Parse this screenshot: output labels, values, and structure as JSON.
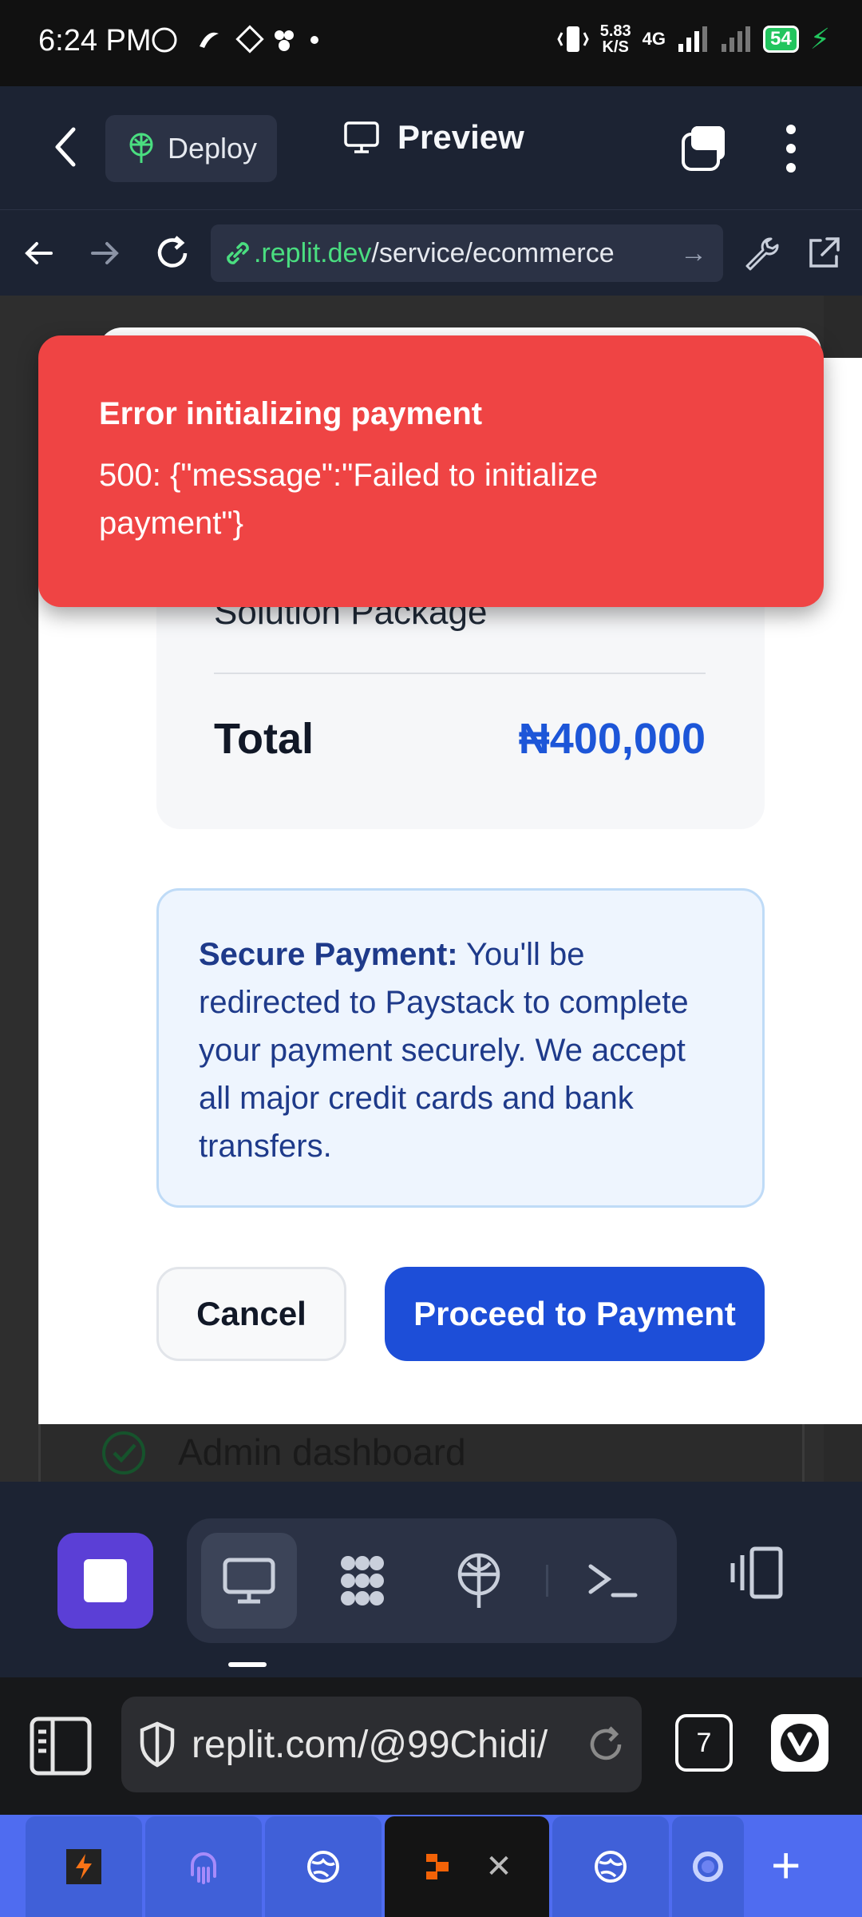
{
  "status_bar": {
    "time": "6:24 PM",
    "net_speed_value": "5.83",
    "net_speed_unit": "K/S",
    "network": "4G",
    "battery": "54"
  },
  "top_bar": {
    "deploy_label": "Deploy",
    "preview_label": "Preview"
  },
  "url_bar": {
    "domain": ".replit.dev",
    "path": "/service/ecommerce"
  },
  "toast": {
    "title": "Error initializing payment",
    "message": "500: {\"message\":\"Failed to initialize payment\"}",
    "color": "#ef4444"
  },
  "checkout": {
    "package_label": "Solution Package",
    "total_label": "Total",
    "total_value": "₦400,000",
    "secure_title": "Secure Payment:",
    "secure_text": " You'll be redirected to Paystack to complete your payment securely. We accept all major credit cards and bank transfers.",
    "cancel_label": "Cancel",
    "proceed_label": "Proceed to Payment",
    "accent": "#1d4ed8"
  },
  "background_list": {
    "item_label": "Admin dashboard"
  },
  "browser": {
    "url": "replit.com/@99Chidi/",
    "tab_count": "7"
  }
}
